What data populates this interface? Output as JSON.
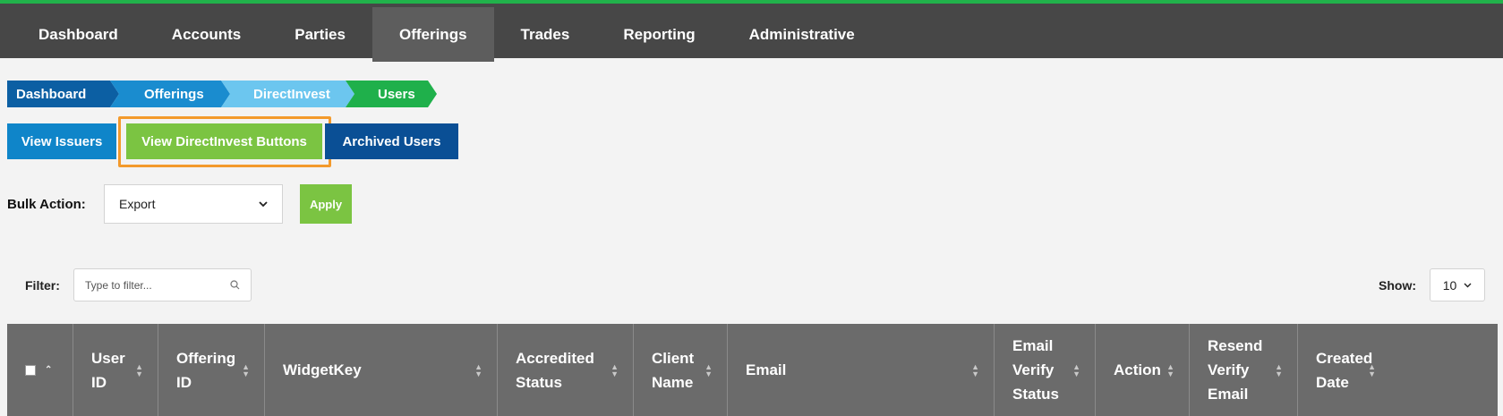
{
  "nav": {
    "items": [
      {
        "label": "Dashboard"
      },
      {
        "label": "Accounts"
      },
      {
        "label": "Parties"
      },
      {
        "label": "Offerings"
      },
      {
        "label": "Trades"
      },
      {
        "label": "Reporting"
      },
      {
        "label": "Administrative"
      }
    ],
    "active": "Offerings"
  },
  "breadcrumb": [
    "Dashboard",
    "Offerings",
    "DirectInvest",
    "Users"
  ],
  "buttons": {
    "view_issuers": "View Issuers",
    "view_directinvest_buttons": "View DirectInvest Buttons",
    "archived_users": "Archived Users"
  },
  "bulk_action": {
    "label": "Bulk Action:",
    "selected": "Export",
    "apply": "Apply"
  },
  "filter": {
    "label": "Filter:",
    "placeholder": "Type to filter..."
  },
  "show": {
    "label": "Show:",
    "value": "10"
  },
  "table": {
    "columns": [
      "User ID",
      "Offering ID",
      "WidgetKey",
      "Accredited Status",
      "Client Name",
      "Email",
      "Email Verify Status",
      "Action",
      "Resend Verify Email",
      "Created Date"
    ]
  },
  "colors": {
    "topbar": "#474747",
    "accent_green": "#7bc442",
    "highlight": "#f39a2c"
  }
}
